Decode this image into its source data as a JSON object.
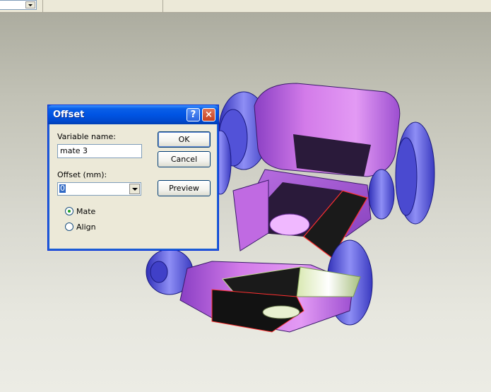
{
  "toolbar": {
    "combo_value": ""
  },
  "dialog": {
    "title": "Offset",
    "help_glyph": "?",
    "close_glyph": "×",
    "variable_name_label": "Variable name:",
    "variable_name_value": "mate 3",
    "offset_label": "Offset (mm):",
    "offset_value": "0",
    "ok_label": "OK",
    "cancel_label": "Cancel",
    "preview_label": "Preview",
    "mode_options": [
      {
        "label": "Mate",
        "checked": true
      },
      {
        "label": "Align",
        "checked": false
      }
    ]
  },
  "colors": {
    "part_body": "#d37be9",
    "part_shadow": "#6b2fa0",
    "part_rollers": "#6e6ee8",
    "selected_face": "#2a2a2a",
    "highlight_edge": "#ff3030",
    "titlebar": "#0054e3",
    "dialog_bg": "#ece9d8"
  }
}
